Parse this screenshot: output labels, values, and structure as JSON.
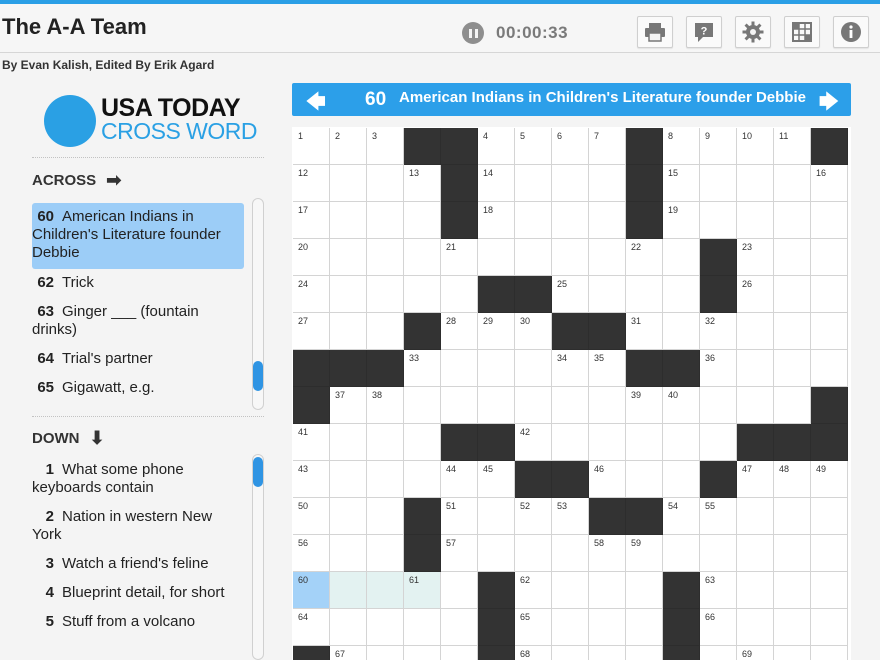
{
  "header": {
    "title": "The A-A Team",
    "timer": "00:00:33",
    "toolbar": [
      "print-icon",
      "help-icon",
      "settings-icon",
      "grid-icon",
      "info-icon"
    ]
  },
  "byline": "By Evan Kalish, Edited By Erik Agard",
  "logo": {
    "line1": "USA TODAY",
    "line2": "CROSS WORD"
  },
  "across": {
    "heading": "ACROSS",
    "clues": [
      {
        "num": "60",
        "text": "American Indians in Children's Literature founder Debbie",
        "active": true
      },
      {
        "num": "62",
        "text": "Trick"
      },
      {
        "num": "63",
        "text": "Ginger ___ (fountain drinks)"
      },
      {
        "num": "64",
        "text": "Trial's partner"
      },
      {
        "num": "65",
        "text": "Gigawatt, e.g."
      }
    ]
  },
  "down": {
    "heading": "DOWN",
    "clues": [
      {
        "num": "1",
        "text": "What some phone keyboards contain"
      },
      {
        "num": "2",
        "text": "Nation in western New York"
      },
      {
        "num": "3",
        "text": "Watch a friend's feline"
      },
      {
        "num": "4",
        "text": "Blueprint detail, for short"
      },
      {
        "num": "5",
        "text": "Stuff from a volcano"
      }
    ]
  },
  "current_clue": {
    "num": "60",
    "text": "American Indians in Children's Literature founder Debbie"
  },
  "grid": {
    "cols": 15,
    "rows": [
      {
        "black": [
          3,
          4,
          9,
          14
        ],
        "numbers": [
          [
            0,
            "1"
          ],
          [
            1,
            "2"
          ],
          [
            2,
            "3"
          ],
          [
            5,
            "4"
          ],
          [
            6,
            "5"
          ],
          [
            7,
            "6"
          ],
          [
            8,
            "7"
          ],
          [
            10,
            "8"
          ],
          [
            11,
            "9"
          ],
          [
            12,
            "10"
          ],
          [
            13,
            "11"
          ]
        ]
      },
      {
        "black": [
          4,
          9
        ],
        "numbers": [
          [
            0,
            "12"
          ],
          [
            3,
            "13"
          ],
          [
            5,
            "14"
          ],
          [
            10,
            "15"
          ],
          [
            14,
            "16"
          ]
        ]
      },
      {
        "black": [
          4,
          9
        ],
        "numbers": [
          [
            0,
            "17"
          ],
          [
            5,
            "18"
          ],
          [
            10,
            "19"
          ]
        ]
      },
      {
        "black": [
          11
        ],
        "numbers": [
          [
            0,
            "20"
          ],
          [
            4,
            "21"
          ],
          [
            9,
            "22"
          ],
          [
            12,
            "23"
          ]
        ]
      },
      {
        "black": [
          5,
          6,
          11
        ],
        "numbers": [
          [
            0,
            "24"
          ],
          [
            7,
            "25"
          ],
          [
            12,
            "26"
          ]
        ]
      },
      {
        "black": [
          3,
          7,
          8
        ],
        "numbers": [
          [
            0,
            "27"
          ],
          [
            4,
            "28"
          ],
          [
            5,
            "29"
          ],
          [
            6,
            "30"
          ],
          [
            9,
            "31"
          ],
          [
            11,
            "32"
          ]
        ]
      },
      {
        "black": [
          0,
          1,
          2,
          9,
          10
        ],
        "numbers": [
          [
            3,
            "33"
          ],
          [
            7,
            "34"
          ],
          [
            8,
            "35"
          ],
          [
            11,
            "36"
          ]
        ]
      },
      {
        "black": [
          0,
          14
        ],
        "numbers": [
          [
            1,
            "37"
          ],
          [
            2,
            "38"
          ],
          [
            9,
            "39"
          ],
          [
            10,
            "40"
          ]
        ]
      },
      {
        "black": [
          4,
          5,
          12,
          13,
          14
        ],
        "numbers": [
          [
            0,
            "41"
          ],
          [
            6,
            "42"
          ]
        ]
      },
      {
        "black": [
          6,
          7,
          11
        ],
        "numbers": [
          [
            0,
            "43"
          ],
          [
            4,
            "44"
          ],
          [
            5,
            "45"
          ],
          [
            8,
            "46"
          ],
          [
            12,
            "47"
          ],
          [
            13,
            "48"
          ],
          [
            14,
            "49"
          ]
        ]
      },
      {
        "black": [
          3,
          8,
          9
        ],
        "numbers": [
          [
            0,
            "50"
          ],
          [
            4,
            "51"
          ],
          [
            6,
            "52"
          ],
          [
            7,
            "53"
          ],
          [
            10,
            "54"
          ],
          [
            11,
            "55"
          ]
        ]
      },
      {
        "black": [
          3
        ],
        "numbers": [
          [
            0,
            "56"
          ],
          [
            4,
            "57"
          ],
          [
            8,
            "58"
          ],
          [
            9,
            "59"
          ]
        ]
      },
      {
        "black": [
          5,
          10
        ],
        "numbers": [
          [
            0,
            "60"
          ],
          [
            3,
            "61"
          ],
          [
            6,
            "62"
          ],
          [
            11,
            "63"
          ]
        ]
      },
      {
        "black": [
          5,
          10
        ],
        "numbers": [
          [
            0,
            "64"
          ],
          [
            6,
            "65"
          ],
          [
            11,
            "66"
          ]
        ]
      },
      {
        "black": [
          0,
          5,
          10
        ],
        "numbers": [
          [
            1,
            "67"
          ],
          [
            6,
            "68"
          ],
          [
            12,
            "69"
          ]
        ]
      }
    ],
    "highlight": {
      "row": 12,
      "cells": [
        0,
        1,
        2,
        3
      ],
      "selected": 0
    }
  },
  "colors": {
    "accent": "#2c9fe9",
    "active_clue": "#9ccdf7",
    "black_square": "#333333",
    "highlight": "#e3f2f1"
  }
}
